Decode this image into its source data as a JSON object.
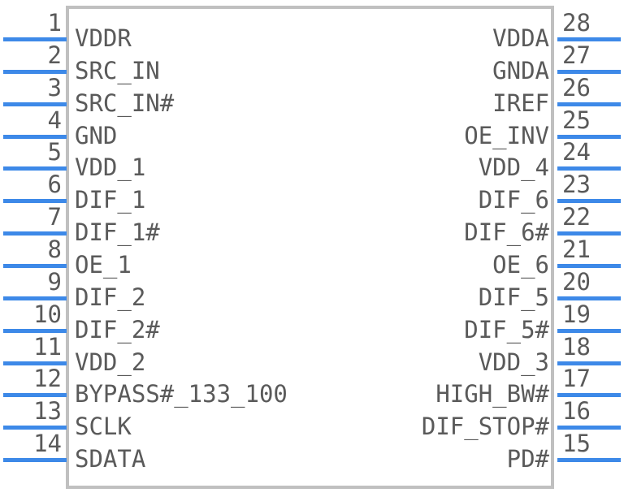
{
  "symbol": {
    "pin_count": 28,
    "colors": {
      "pin_line": "#3d89e8",
      "body_border": "#c0c0c0",
      "text": "#5a5a5a",
      "background": "#ffffff"
    },
    "left_pins": [
      {
        "number": "1",
        "label": "VDDR"
      },
      {
        "number": "2",
        "label": "SRC_IN"
      },
      {
        "number": "3",
        "label": "SRC_IN#"
      },
      {
        "number": "4",
        "label": "GND"
      },
      {
        "number": "5",
        "label": "VDD_1"
      },
      {
        "number": "6",
        "label": "DIF_1"
      },
      {
        "number": "7",
        "label": "DIF_1#"
      },
      {
        "number": "8",
        "label": "OE_1"
      },
      {
        "number": "9",
        "label": "DIF_2"
      },
      {
        "number": "10",
        "label": "DIF_2#"
      },
      {
        "number": "11",
        "label": "VDD_2"
      },
      {
        "number": "12",
        "label": "BYPASS#_133_100"
      },
      {
        "number": "13",
        "label": "SCLK"
      },
      {
        "number": "14",
        "label": "SDATA"
      }
    ],
    "right_pins": [
      {
        "number": "28",
        "label": "VDDA"
      },
      {
        "number": "27",
        "label": "GNDA"
      },
      {
        "number": "26",
        "label": "IREF"
      },
      {
        "number": "25",
        "label": "OE_INV"
      },
      {
        "number": "24",
        "label": "VDD_4"
      },
      {
        "number": "23",
        "label": "DIF_6"
      },
      {
        "number": "22",
        "label": "DIF_6#"
      },
      {
        "number": "21",
        "label": "OE_6"
      },
      {
        "number": "20",
        "label": "DIF_5"
      },
      {
        "number": "19",
        "label": "DIF_5#"
      },
      {
        "number": "18",
        "label": "VDD_3"
      },
      {
        "number": "17",
        "label": "HIGH_BW#"
      },
      {
        "number": "16",
        "label": "DIF_STOP#"
      },
      {
        "number": "15",
        "label": "PD#"
      }
    ]
  }
}
